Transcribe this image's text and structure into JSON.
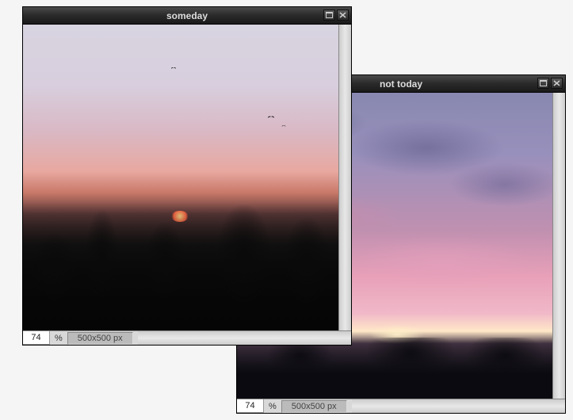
{
  "windows": [
    {
      "title": "someday",
      "zoom": "74",
      "zoom_unit": "%",
      "dimensions": "500x500 px"
    },
    {
      "title": "not today",
      "zoom": "74",
      "zoom_unit": "%",
      "dimensions": "500x500 px"
    }
  ]
}
